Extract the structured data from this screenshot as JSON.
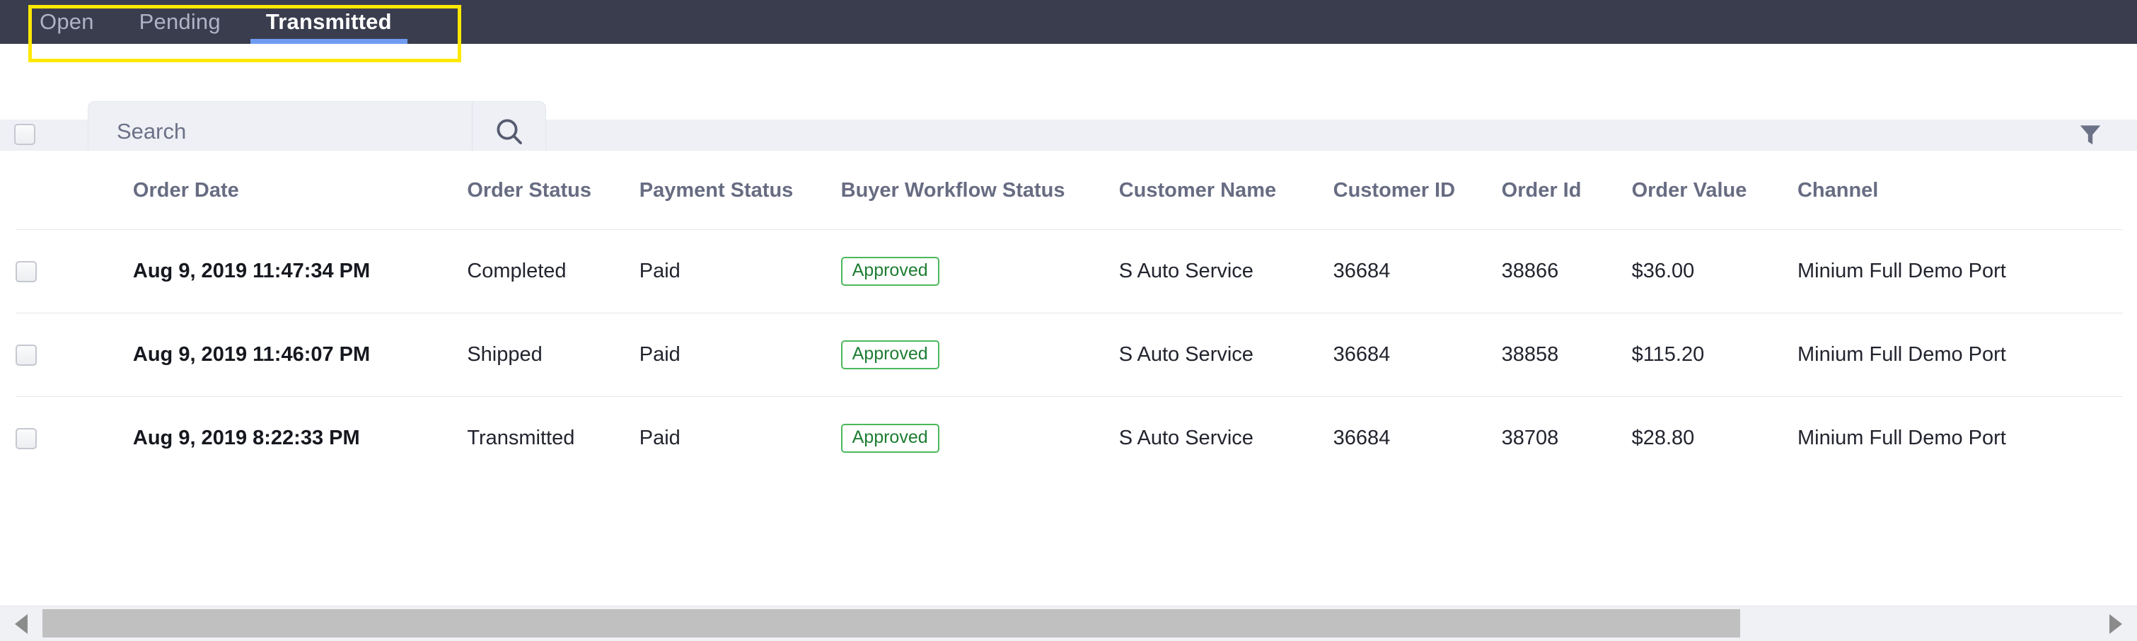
{
  "topnav": {
    "tabs": [
      {
        "label": "Open",
        "active": false
      },
      {
        "label": "Pending",
        "active": false
      },
      {
        "label": "Transmitted",
        "active": true
      }
    ],
    "active_indicator_color": "#6f9cf0",
    "background_color": "#3a3d4d",
    "annotation_box_color": "#ffe800"
  },
  "toolbar": {
    "select_all_checkbox": "",
    "search": {
      "value": "",
      "placeholder": "Search"
    },
    "search_button_icon": "search-icon",
    "filter_button_icon": "filter-funnel-icon",
    "filter_icon_color": "#6b7187"
  },
  "table": {
    "columns": [
      "Order Date",
      "Order Status",
      "Payment Status",
      "Buyer Workflow Status",
      "Customer Name",
      "Customer ID",
      "Order Id",
      "Order Value",
      "Channel"
    ],
    "rows": [
      {
        "order_date": "Aug 9, 2019 11:47:34 PM",
        "order_status": "Completed",
        "payment_status": "Paid",
        "buyer_workflow_status": "Approved",
        "customer_name": "S Auto Service",
        "customer_id": "36684",
        "order_id": "38866",
        "order_value": "$36.00",
        "channel": "Minium Full Demo Port"
      },
      {
        "order_date": "Aug 9, 2019 11:46:07 PM",
        "order_status": "Shipped",
        "payment_status": "Paid",
        "buyer_workflow_status": "Approved",
        "customer_name": "S Auto Service",
        "customer_id": "36684",
        "order_id": "38858",
        "order_value": "$115.20",
        "channel": "Minium Full Demo Port"
      },
      {
        "order_date": "Aug 9, 2019 8:22:33 PM",
        "order_status": "Transmitted",
        "payment_status": "Paid",
        "buyer_workflow_status": "Approved",
        "customer_name": "S Auto Service",
        "customer_id": "36684",
        "order_id": "38708",
        "order_value": "$28.80",
        "channel": "Minium Full Demo Port"
      }
    ],
    "badge_border_color": "#4cb85c",
    "badge_text_color": "#1e7d33"
  },
  "scrollbar": {
    "left_arrow_icon": "chevron-left-icon",
    "right_arrow_icon": "chevron-right-icon",
    "thumb_color": "#c0c0c0"
  }
}
